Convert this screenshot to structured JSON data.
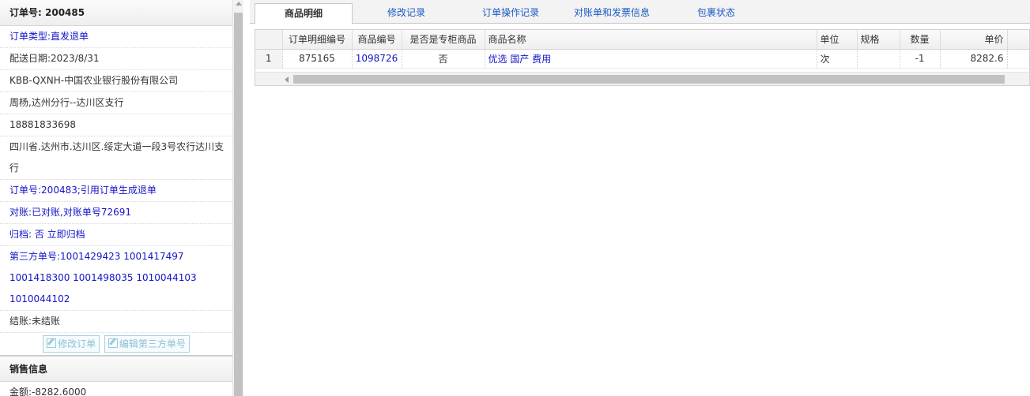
{
  "order": {
    "title_label": "订单号:",
    "title_value": "200485",
    "type": "订单类型:直发退单",
    "delivery_date": "配送日期:2023/8/31",
    "customer": "KBB-QXNH-中国农业银行股份有限公司",
    "contact": "周杨,达州分行--达川区支行",
    "phone": "18881833698",
    "address": "四川省.达州市.达川区.绥定大道一段3号农行达川支行",
    "ref_order": "订单号:200483;引用订单生成退单",
    "reconcile": "对账:已对账,对账单号72691",
    "archive_label": "归档: ",
    "archive_value": "否 立即归档",
    "third_party_label": "第三方单号:",
    "third_party_numbers": "1001429423 1001417497 1001418300 1001498035 1010044103 1010044102",
    "settlement_label": "结账:",
    "settlement_value": "未结账",
    "edit_order_button": "修改订单",
    "edit_third_party_button": "编辑第三方单号"
  },
  "sales": {
    "title": "销售信息",
    "amount_label": "金额:",
    "amount_value": "-8282.6000"
  },
  "tabs": [
    {
      "label": "商品明细",
      "active": true
    },
    {
      "label": "修改记录"
    },
    {
      "label": "订单操作记录"
    },
    {
      "label": "对账单和发票信息"
    },
    {
      "label": "包裹状态"
    }
  ],
  "grid": {
    "columns": [
      "",
      "订单明细编号",
      "商品编号",
      "是否是专柜商品",
      "商品名称",
      "单位",
      "规格",
      "数量",
      "单价"
    ],
    "rows": [
      {
        "row_num": "1",
        "detail_id": "875165",
        "product_id": "1098726",
        "is_counter": "否",
        "product_name": "优选 国产 费用",
        "unit": "次",
        "spec": "",
        "qty": "-1",
        "price": "8282.6"
      }
    ]
  },
  "colors": {
    "link": "#1414c8",
    "accent_blue": "#1a5bc4"
  }
}
